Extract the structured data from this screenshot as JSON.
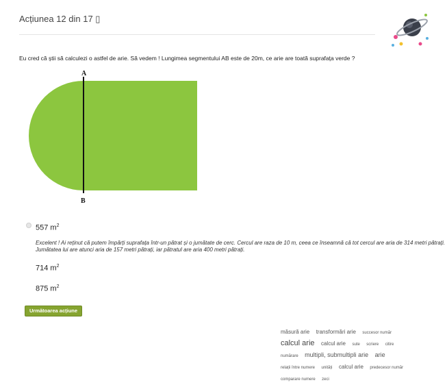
{
  "header": {
    "title": "Acțiunea 12 din 17 ▯"
  },
  "question": {
    "text": "Eu cred că știi să calculezi o astfel de arie. Să vedem ! Lungimea segmentului AB este de 20m, ce arie are toată suprafața verde ?"
  },
  "figure": {
    "label_top": "A",
    "label_bottom": "B",
    "fill_color": "#8cc63f"
  },
  "answers": [
    {
      "value": "557 m",
      "unit_exp": "2",
      "selected": true
    },
    {
      "value": "714 m",
      "unit_exp": "2",
      "selected": false
    },
    {
      "value": "875 m",
      "unit_exp": "2",
      "selected": false
    }
  ],
  "explanation": "Excelent ! Ai reținut că putem împărți suprafața într-un pătrat și o jumătate de cerc. Cercul are raza de 10 m, ceea ce înseamnă că tot cercul are aria de 314 metri pătrați. Jumătatea lui are atunci aria de 157 metri pătrați, iar pătratul are aria 400 metri pătrați.",
  "next_button": {
    "label": "Următoarea acțiune"
  },
  "tags": [
    {
      "text": "măsură arie",
      "size": "m"
    },
    {
      "text": "transformări arie",
      "size": "m"
    },
    {
      "text": "succesor număr",
      "size": "s"
    },
    {
      "text": "calcul arie",
      "size": "xl"
    },
    {
      "text": "calcul arie",
      "size": "m"
    },
    {
      "text": "sute",
      "size": "s"
    },
    {
      "text": "scriere",
      "size": "s"
    },
    {
      "text": "citire",
      "size": "s"
    },
    {
      "text": "numărare",
      "size": "s"
    },
    {
      "text": "multipli, submultipli arie",
      "size": "l"
    },
    {
      "text": "arie",
      "size": "l"
    },
    {
      "text": "relații între numere",
      "size": "s"
    },
    {
      "text": "unități",
      "size": "s"
    },
    {
      "text": "calcul arie",
      "size": "m"
    },
    {
      "text": "predecesor număr",
      "size": "s"
    },
    {
      "text": "comparare numere",
      "size": "s"
    },
    {
      "text": "zeci",
      "size": "s"
    }
  ]
}
